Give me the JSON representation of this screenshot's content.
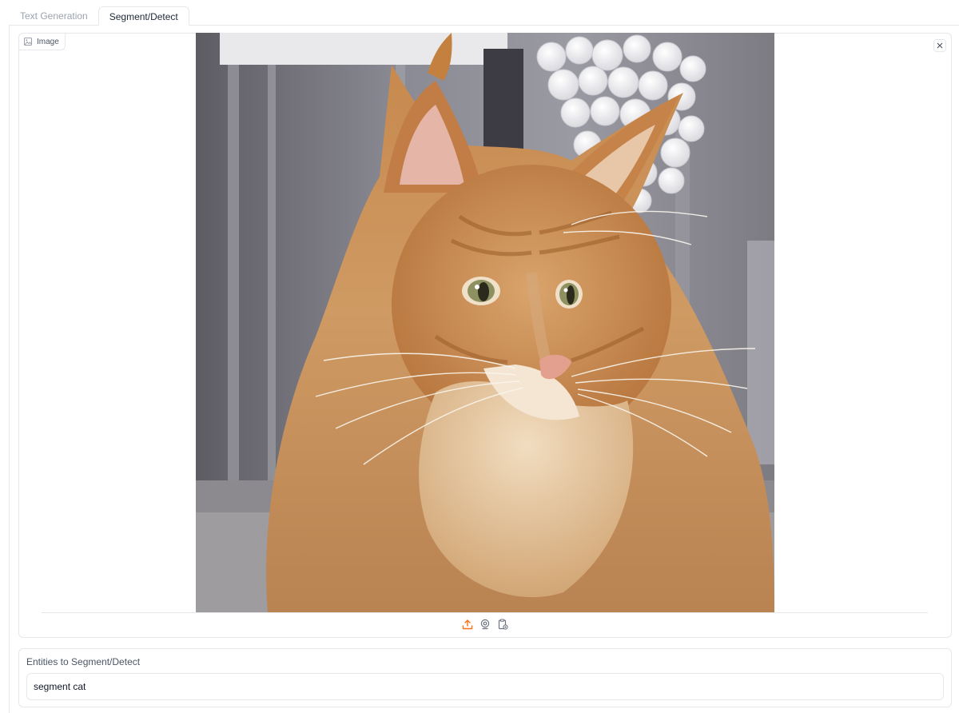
{
  "tabs": [
    {
      "label": "Text Generation",
      "selected": false
    },
    {
      "label": "Segment/Detect",
      "selected": true
    }
  ],
  "image_input": {
    "label": "Image",
    "label_icon": "image-icon",
    "clear_icon": "close-icon",
    "source_icons": [
      "upload-icon",
      "webcam-icon",
      "clipboard-icon"
    ],
    "accent_color": "#f97316"
  },
  "entities_input": {
    "label": "Entities to Segment/Detect",
    "value": "segment cat"
  }
}
